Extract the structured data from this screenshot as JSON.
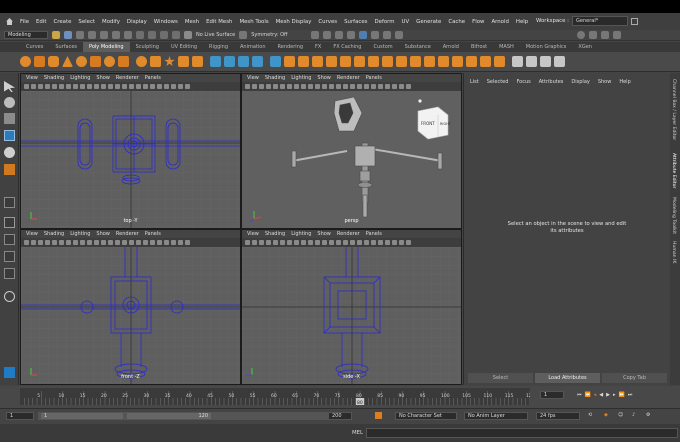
{
  "menubar": {
    "items": [
      "File",
      "Edit",
      "Create",
      "Select",
      "Modify",
      "Display",
      "Windows",
      "Mesh",
      "Edit Mesh",
      "Mesh Tools",
      "Mesh Display",
      "Curves",
      "Surfaces",
      "Deform",
      "UV",
      "Generate",
      "Cache",
      "Flow",
      "Arnold",
      "Help"
    ],
    "workspace_label": "Workspace :",
    "workspace_value": "General*"
  },
  "statusline": {
    "mode": "Modeling",
    "live_surface": "No Live Surface",
    "symmetry": "Symmetry: Off"
  },
  "shelf": {
    "tabs": [
      "Curves",
      "Surfaces",
      "Poly Modeling",
      "Sculpting",
      "UV Editing",
      "Rigging",
      "Animation",
      "Rendering",
      "FX",
      "FX Caching",
      "Custom",
      "Substance",
      "Arnold",
      "Bifrost",
      "MASH",
      "Motion Graphics",
      "XGen"
    ],
    "active_tab": "Poly Modeling"
  },
  "viewport_menu": [
    "View",
    "Shading",
    "Lighting",
    "Show",
    "Renderer",
    "Panels"
  ],
  "viewports": {
    "top": "top -Y",
    "persp": "persp",
    "front": "front -Z",
    "side": "side -X"
  },
  "viewcube": {
    "front": "FRONT",
    "right": "RIGHT"
  },
  "attr": {
    "menu": [
      "List",
      "Selected",
      "Focus",
      "Attributes",
      "Display",
      "Show",
      "Help"
    ],
    "message": "Select an object in the scene to view and edit its attributes",
    "buttons": [
      "Select",
      "Load Attributes",
      "Copy Tab"
    ]
  },
  "sidetabs": [
    "Channel Box / Layer Editor",
    "Attribute Editor",
    "Modeling Toolkit",
    "Human IK"
  ],
  "timeline": {
    "ticks": [
      "5",
      "10",
      "15",
      "20",
      "25",
      "30",
      "35",
      "40",
      "45",
      "50",
      "55",
      "60",
      "65",
      "70",
      "75",
      "80",
      "85",
      "90",
      "95",
      "100",
      "105",
      "110",
      "115",
      "120"
    ],
    "current_frame": "80",
    "frame_field": "1"
  },
  "range": {
    "start_outer": "1",
    "start_inner": "1",
    "end_inner": "120",
    "end_outer": "200",
    "character_set": "No Character Set",
    "anim_layer": "No Anim Layer",
    "fps": "24 fps"
  },
  "cmd": {
    "label": "MEL"
  },
  "colors": {
    "accent": "#e07b1e",
    "active_tab": "#5d5d5d",
    "viewport_bg": "#5f5f5f",
    "wire": "#2a2ad0"
  }
}
